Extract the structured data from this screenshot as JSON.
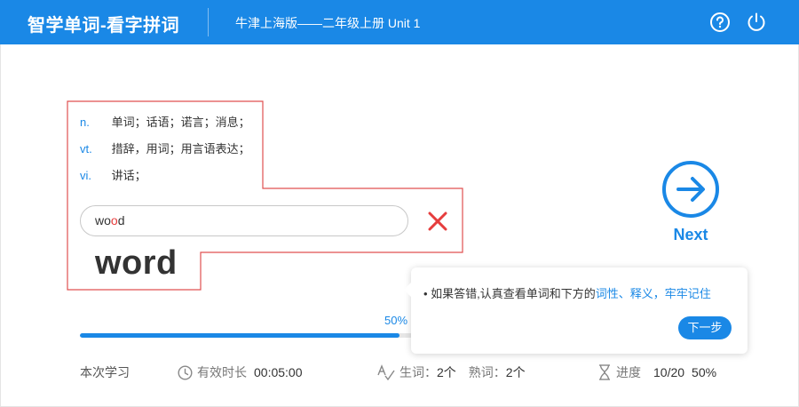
{
  "header": {
    "app_title": "智学单词-看字拼词",
    "book_title": "牛津上海版——二年级上册 Unit 1",
    "help_icon": "question-circle-icon",
    "power_icon": "power-icon"
  },
  "definitions": [
    {
      "pos": "n.",
      "text": "单词；话语；诺言；消息；"
    },
    {
      "pos": "vt.",
      "text": "措辞，用词；用言语表达；"
    },
    {
      "pos": "vi.",
      "text": "讲话；"
    }
  ],
  "answer": {
    "prefix": "wo",
    "wrong_letter": "o",
    "suffix": "d",
    "status_icon": "wrong-x-icon"
  },
  "correct_word": "word",
  "next": {
    "label": "Next",
    "icon": "arrow-right-circle-icon"
  },
  "progress": {
    "percent_label": "50%",
    "fraction": 0.5
  },
  "tooltip": {
    "text_plain": "如果答错,认真查看单词和下方的",
    "text_highlight": "词性、释义，牢牢记住",
    "button_label": "下一步"
  },
  "footer": {
    "session_label": "本次学习",
    "time_label": "有效时长",
    "time_value": "00:05:00",
    "new_words_label": "生词：",
    "new_words_value": "2个",
    "known_words_label": "熟词：",
    "known_words_value": "2个",
    "progress_label": "进度",
    "progress_count": "10/20",
    "progress_percent": "50%"
  },
  "colors": {
    "primary": "#1a88e6",
    "error": "#e63d3d",
    "outline": "#e05050"
  }
}
